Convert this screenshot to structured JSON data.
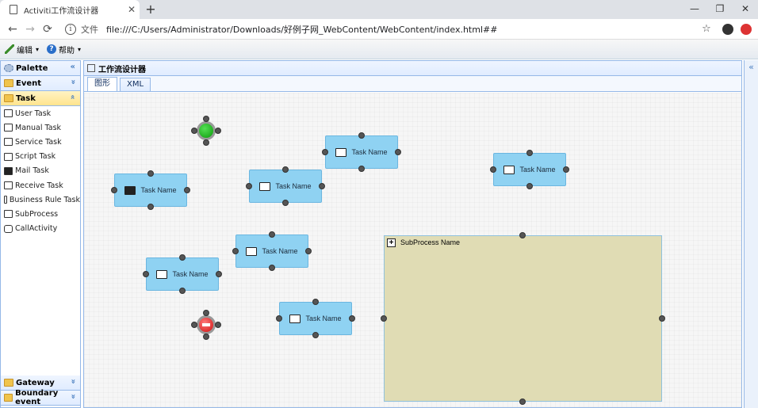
{
  "browser": {
    "tab_title": "Activiti工作流设计器",
    "tab_close": "✕",
    "new_tab": "+",
    "url_scheme": "文件",
    "url": "file:///C:/Users/Administrator/Downloads/好例子网_WebContent/WebContent/index.html##",
    "back": "←",
    "forward": "→",
    "reload": "⟳",
    "info": "i",
    "star": "☆",
    "minimize": "—",
    "maximize": "❐",
    "close": "✕"
  },
  "toolbar": {
    "edit_label": "编辑",
    "help_label": "帮助",
    "help_glyph": "?",
    "caret": "▾"
  },
  "palette": {
    "title": "Palette",
    "collapse": "«",
    "event": "Event",
    "task": "Task",
    "expand_down": "»",
    "expand_up": "»",
    "items": [
      {
        "label": "User Task",
        "icon": "user-task-icon"
      },
      {
        "label": "Manual Task",
        "icon": "manual-task-icon"
      },
      {
        "label": "Service Task",
        "icon": "service-task-icon"
      },
      {
        "label": "Script Task",
        "icon": "script-task-icon"
      },
      {
        "label": "Mail Task",
        "icon": "mail-task-icon"
      },
      {
        "label": "Receive Task",
        "icon": "receive-task-icon"
      },
      {
        "label": "Business Rule Task",
        "icon": "business-rule-task-icon"
      },
      {
        "label": "SubProcess",
        "icon": "subprocess-icon"
      },
      {
        "label": "CallActivity",
        "icon": "call-activity-icon"
      }
    ],
    "gateway": "Gateway",
    "boundary": "Boundary event"
  },
  "main": {
    "title": "工作流设计器",
    "tabs": [
      "图形",
      "XML"
    ]
  },
  "diagram": {
    "task_label": "Task Name",
    "subprocess_label": "SubProcess Name",
    "subprocess_plus": "+"
  },
  "rightcol": {
    "collapse": "«"
  }
}
